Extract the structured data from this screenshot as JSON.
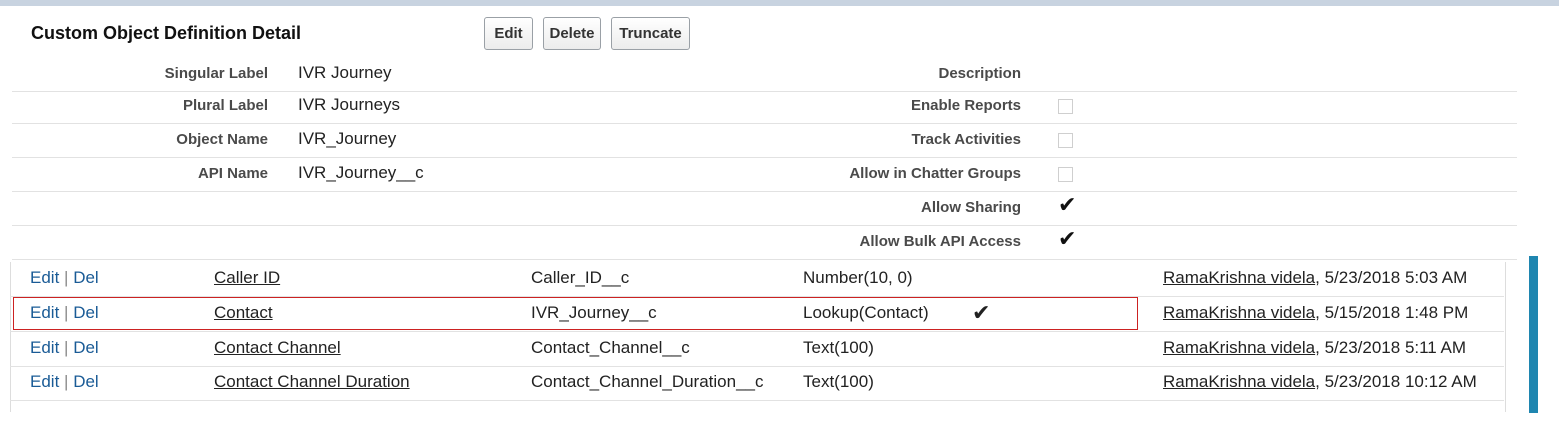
{
  "title": "Custom Object Definition Detail",
  "buttons": {
    "edit": "Edit",
    "delete": "Delete",
    "truncate": "Truncate"
  },
  "details": {
    "singular_label": {
      "label": "Singular Label",
      "value": "IVR Journey"
    },
    "plural_label": {
      "label": "Plural Label",
      "value": "IVR Journeys"
    },
    "object_name": {
      "label": "Object Name",
      "value": "IVR_Journey"
    },
    "api_name": {
      "label": "API Name",
      "value": "IVR_Journey__c"
    },
    "description": {
      "label": "Description",
      "value": ""
    },
    "enable_reports": {
      "label": "Enable Reports",
      "checked": false
    },
    "track_activities": {
      "label": "Track Activities",
      "checked": false
    },
    "allow_chatter_groups": {
      "label": "Allow in Chatter Groups",
      "checked": false
    },
    "allow_sharing": {
      "label": "Allow Sharing",
      "checked": true
    },
    "allow_bulk_api": {
      "label": "Allow Bulk API Access",
      "checked": true
    }
  },
  "field_actions": {
    "edit": "Edit",
    "separator": "|",
    "del": "Del"
  },
  "check_glyph": "✔",
  "fields": [
    {
      "label": "Caller ID",
      "api": "Caller_ID__c",
      "type": "Number(10, 0)",
      "checked": false,
      "modified_by": "RamaKrishna videla",
      "modified_date": ", 5/23/2018 5:03 AM"
    },
    {
      "label": "Contact",
      "api": "IVR_Journey__c",
      "type": "Lookup(Contact)",
      "checked": true,
      "modified_by": "RamaKrishna videla",
      "modified_date": ", 5/15/2018 1:48 PM"
    },
    {
      "label": "Contact Channel",
      "api": "Contact_Channel__c",
      "type": "Text(100)",
      "checked": false,
      "modified_by": "RamaKrishna videla",
      "modified_date": ", 5/23/2018 5:11 AM"
    },
    {
      "label": "Contact Channel Duration",
      "api": "Contact_Channel_Duration__c",
      "type": "Text(100)",
      "checked": false,
      "modified_by": "RamaKrishna videla",
      "modified_date": ", 5/23/2018 10:12 AM"
    }
  ],
  "colors": {
    "link": "#1a5b96",
    "highlight_border": "#cc2222",
    "scrollbar": "#1f86b0"
  }
}
